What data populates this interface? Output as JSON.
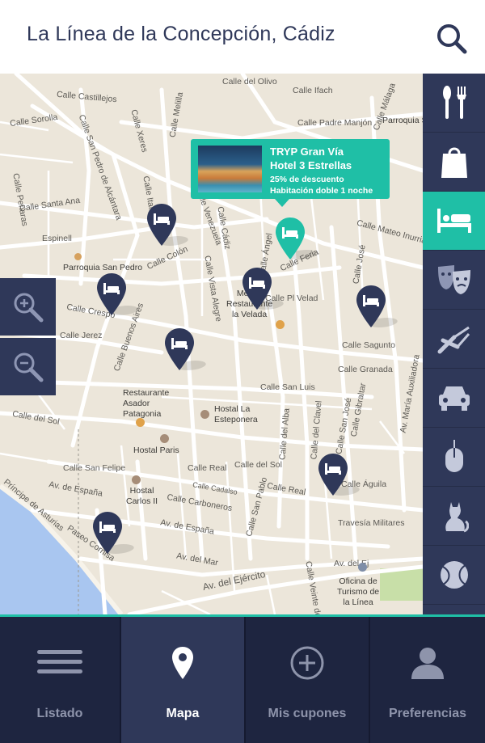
{
  "header": {
    "title": "La Línea de la Concepción, Cádiz",
    "search_icon": "search-icon"
  },
  "map": {
    "streets": [
      "Calle del Olivo",
      "Calle Ifach",
      "Calle Castillejos",
      "Calle Sorolla",
      "Calle Melilla",
      "Calle Padre Manjón",
      "Calle Málaga",
      "Parroquia San José",
      "Calle Xeres",
      "Calle San Pedro de Alcántara",
      "Calle Italia",
      "Calle Peñaras",
      "Calle Santa Ana",
      "Espinell",
      "Calle Venezuela",
      "Calle Cádiz",
      "Calle Ángel",
      "Calle Mateo Inurria",
      "Calle Colón",
      "Calle Vista Alegre",
      "Calle Feria",
      "Calle José",
      "Calle Crespo",
      "Calle Buenos Aires",
      "Calle Pl Velad",
      "Calle Jerez",
      "Calle Sagunto",
      "Calle Granada",
      "Calle San Luis",
      "Calle del Sol",
      "Calle del Alba",
      "Calle del Clavel",
      "Calle San José",
      "Calle Gibraltar",
      "Av. María Auxiliadora",
      "Calle San Felipe",
      "Av. de España",
      "Calle Real",
      "Calle del Sol",
      "Calle Cadalso",
      "Calle Carboneros",
      "Calle San Pablo",
      "Calle Real",
      "Calle Águila",
      "Travesía Militares",
      "Príncipe de Asturias",
      "Paseo Cornisa",
      "Av. de España",
      "Av. del Mar",
      "Av. del Ejército",
      "Av. del Ejército",
      "Av. del Ej",
      "Calle Veinte de"
    ],
    "pois": {
      "parroquia_san_pedro": "Parroquia San Pedro",
      "meson": "Meson\nRestaurante\nla Velada",
      "restaurante_asador": "Restaurante\nAsador\nPatagonia",
      "hostal_esteponera": "Hostal La\nEsteponera",
      "hostal_paris": "Hostal Paris",
      "hostal_carlos": "Hostal\nCarlos II",
      "oficina_turismo": "Oficina de\nTurismo de\nla Línea"
    },
    "zoom_in_icon": "zoom-in-icon",
    "zoom_out_icon": "zoom-out-icon",
    "popup": {
      "title_line1": "TRYP Gran Vía",
      "title_line2": "Hotel 3 Estrellas",
      "offer_line1": "25% de descuento",
      "offer_line2": "Habitación doble 1 noche"
    }
  },
  "categories": [
    {
      "icon": "restaurant-icon",
      "active": false
    },
    {
      "icon": "shopping-bag-icon",
      "active": false
    },
    {
      "icon": "hotel-bed-icon",
      "active": true
    },
    {
      "icon": "theater-masks-icon",
      "active": false
    },
    {
      "icon": "tools-icon",
      "active": false
    },
    {
      "icon": "car-icon",
      "active": false
    },
    {
      "icon": "mouse-icon",
      "active": false
    },
    {
      "icon": "cat-icon",
      "active": false
    },
    {
      "icon": "ball-icon",
      "active": false
    }
  ],
  "tabs": [
    {
      "label": "Listado",
      "icon": "list-icon",
      "active": false
    },
    {
      "label": "Mapa",
      "icon": "location-pin-icon",
      "active": true
    },
    {
      "label": "Mis cupones",
      "icon": "add-circle-icon",
      "active": false
    },
    {
      "label": "Preferencias",
      "icon": "user-icon",
      "active": false
    }
  ],
  "colors": {
    "navy": "#2f3859",
    "dark_navy": "#1e2540",
    "teal": "#1fbfa6",
    "map_bg": "#ece6da",
    "water": "#a9c6f0",
    "park": "#c8dfa8"
  }
}
